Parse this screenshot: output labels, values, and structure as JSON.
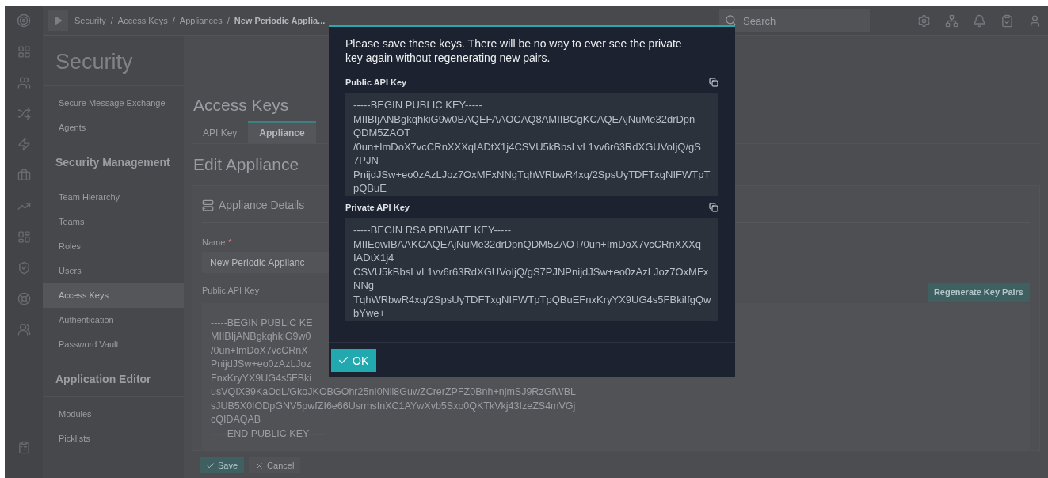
{
  "top_bar": {
    "separator": "/",
    "breadcrumb": [
      {
        "label": "Security",
        "current": false
      },
      {
        "label": "Access Keys",
        "current": false
      },
      {
        "label": "Appliances",
        "current": false
      },
      {
        "label": "New Periodic Applia...",
        "current": true
      }
    ],
    "search": {
      "placeholder": "Search"
    }
  },
  "sidebar": {
    "title": "Security",
    "items": [
      {
        "kind": "item",
        "label": "Secure Message Exchange",
        "selected": false
      },
      {
        "kind": "item",
        "label": "Agents",
        "selected": false
      },
      {
        "kind": "heading",
        "label": "Security Management"
      },
      {
        "kind": "item",
        "label": "Team Hierarchy",
        "selected": false
      },
      {
        "kind": "item",
        "label": "Teams",
        "selected": false
      },
      {
        "kind": "item",
        "label": "Roles",
        "selected": false
      },
      {
        "kind": "item",
        "label": "Users",
        "selected": false
      },
      {
        "kind": "item",
        "label": "Access Keys",
        "selected": true
      },
      {
        "kind": "item",
        "label": "Authentication",
        "selected": false
      },
      {
        "kind": "item",
        "label": "Password Vault",
        "selected": false
      },
      {
        "kind": "heading",
        "label": "Application Editor"
      },
      {
        "kind": "item",
        "label": "Modules",
        "selected": false
      },
      {
        "kind": "item",
        "label": "Picklists",
        "selected": false
      }
    ]
  },
  "page": {
    "title": "Access Keys",
    "tabs": [
      {
        "label": "API Key",
        "selected": false
      },
      {
        "label": "Appliance",
        "selected": true
      }
    ],
    "form_title": "Edit Appliance",
    "card_title": "Appliance Details",
    "name_label": "Name",
    "required_mark": "*",
    "name_value": "New Periodic Applianc",
    "key_label": "Public API Key",
    "regenerate_button": "Regenerate Key Pairs",
    "key_lines": [
      "-----BEGIN PUBLIC KE",
      "MIIBIjANBgkqhkiG9w0",
      "/0un+ImDoX7vcCRnX",
      "PnijdJSw+eo0zAzLJoz",
      "FnxKryYX9UG4s5FBki",
      "usVQIX89KaOdL/GkoJKOBGOhr25nI0Nii8GuwZCrerZPFZ0Bnh+njmSJ9RzGfWBL",
      "sJUB5X0IODpGNV5pwfZI6e66UsrmsInXC1AYwXvb5Sxo0QKTkVkj43IzeZS4mVGj",
      "cQIDAQAB",
      "-----END PUBLIC KEY-----"
    ],
    "save_button": "Save",
    "cancel_button": "Cancel"
  },
  "modal": {
    "message": "Please save these keys. There will be no way to ever see the private key again without regenerating new pairs.",
    "keys": [
      {
        "label": "Public API Key",
        "lines": [
          "-----BEGIN PUBLIC KEY-----",
          "MIIBIjANBgkqhkiG9w0BAQEFAAOCAQ8AMIIBCgKCAQEAjNuMe32drDpn",
          "QDM5ZAOT",
          "/0un+ImDoX7vcCRnXXXqIADtX1j4CSVU5kBbsLvL1vv6r63RdXGUVoIjQ/gS",
          "7PJN",
          "PnijdJSw+eo0zAzLJoz7OxMFxNNgTqhWRbwR4xq/2SpsUyTDFTxgNIFWTpT",
          "pQBuE"
        ]
      },
      {
        "label": "Private API Key",
        "lines": [
          "-----BEGIN RSA PRIVATE KEY-----",
          "MIIEowIBAAKCAQEAjNuMe32drDpnQDM5ZAOT/0un+ImDoX7vcCRnXXXq",
          "IADtX1j4",
          "CSVU5kBbsLvL1vv6r63RdXGUVoIjQ/gS7PJNPnijdJSw+eo0zAzLJoz7OxMFx",
          "NNg",
          "TqhWRbwR4xq/2SpsUyTDFTxgNIFWTpTpQBuEFnxKryYX9UG4s5FBkiIfgQw",
          "bYwe+"
        ]
      }
    ],
    "ok_button": "OK"
  }
}
